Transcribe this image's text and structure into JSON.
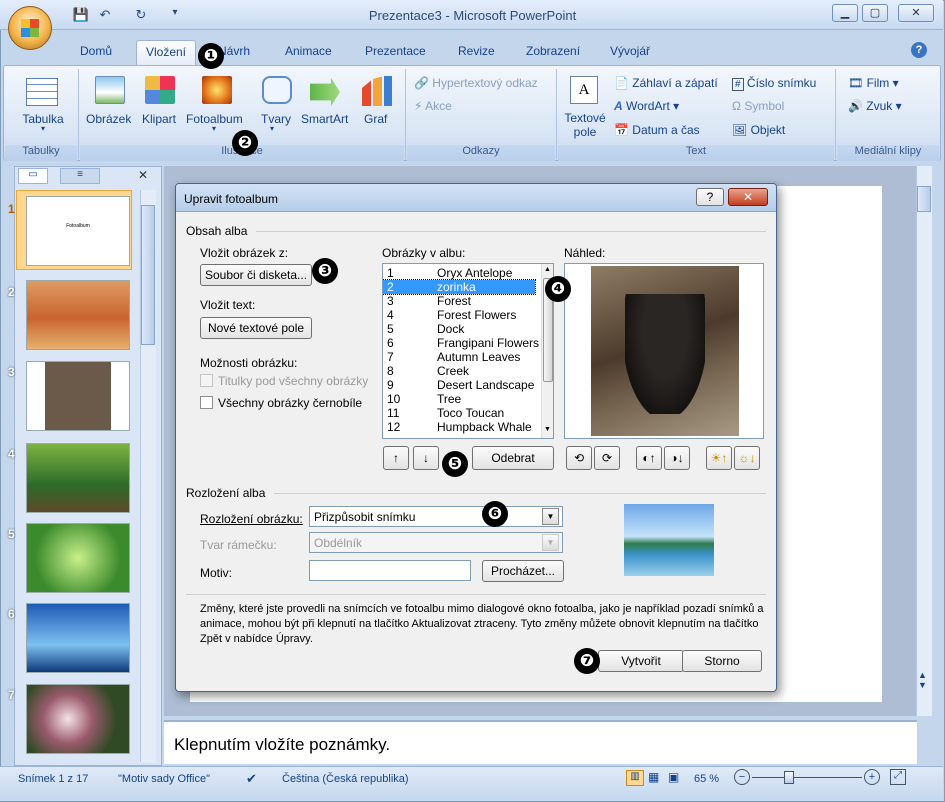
{
  "window": {
    "title": "Prezentace3 - Microsoft PowerPoint"
  },
  "tabs": [
    "Domů",
    "Vložení",
    "Návrh",
    "Animace",
    "Prezentace",
    "Revize",
    "Zobrazení",
    "Vývojář"
  ],
  "ribbon": {
    "tabulka": "Tabulka",
    "obrazek": "Obrázek",
    "klipart": "Klipart",
    "fotoalbum": "Fotoalbum",
    "tvary": "Tvary",
    "smartart": "SmartArt",
    "graf": "Graf",
    "hyper": "Hypertextový odkaz",
    "akce": "Akce",
    "textove_pole": "Textové pole",
    "zahlavi": "Záhlaví a zápatí",
    "wordart": "WordArt",
    "datum": "Datum a čas",
    "cislo": "Číslo snímku",
    "symbol": "Symbol",
    "objekt": "Objekt",
    "film": "Film",
    "zvuk": "Zvuk",
    "groups": {
      "tabulky": "Tabulky",
      "ilustrace": "Ilustrace",
      "odkazy": "Odkazy",
      "text": "Text",
      "media": "Mediální klipy"
    }
  },
  "callouts": [
    "❶",
    "❷",
    "❸",
    "❹",
    "❺",
    "❻",
    "❼"
  ],
  "slides": {
    "numbers": [
      "1",
      "2",
      "3",
      "4",
      "5",
      "6",
      "7"
    ],
    "first_title": "Fotoalbum"
  },
  "dialog": {
    "title": "Upravit fotoalbum",
    "obsah": "Obsah alba",
    "vlozit_obrazek": "Vložit obrázek z:",
    "soubor_btn": "Soubor či disketa...",
    "vlozit_text": "Vložit text:",
    "nove_pole_btn": "Nové textové pole",
    "moznosti": "Možnosti obrázku:",
    "titulky": "Titulky pod všechny obrázky",
    "cernobile": "Všechny obrázky černobíle",
    "obrazky_label": "Obrázky v albu:",
    "nahled": "Náhled:",
    "list": [
      {
        "n": "1",
        "t": "Oryx Antelope"
      },
      {
        "n": "2",
        "t": "zorinka"
      },
      {
        "n": "3",
        "t": "Forest"
      },
      {
        "n": "4",
        "t": "Forest Flowers"
      },
      {
        "n": "5",
        "t": "Dock"
      },
      {
        "n": "6",
        "t": "Frangipani Flowers"
      },
      {
        "n": "7",
        "t": "Autumn Leaves"
      },
      {
        "n": "8",
        "t": "Creek"
      },
      {
        "n": "9",
        "t": "Desert Landscape"
      },
      {
        "n": "10",
        "t": "Tree"
      },
      {
        "n": "11",
        "t": "Toco Toucan"
      },
      {
        "n": "12",
        "t": "Humpback Whale"
      }
    ],
    "odebrat": "Odebrat",
    "rozlozeni_alba": "Rozložení alba",
    "rozlozeni_label": "Rozložení obrázku:",
    "rozlozeni_val": "Přizpůsobit snímku",
    "tvar_label": "Tvar rámečku:",
    "tvar_val": "Obdélník",
    "motiv_label": "Motiv:",
    "prochazet": "Procházet...",
    "note": "Změny, které jste provedli na snímcích ve fotoalbu mimo dialogové okno fotoalba, jako je například pozadí snímků a animace, mohou být při klepnutí na tlačítko Aktualizovat ztraceny. Tyto změny můžete obnovit klepnutím na tlačítko Zpět v nabídce Úpravy.",
    "vytvorit": "Vytvořit",
    "storno": "Storno",
    "help": "?",
    "close": "✕"
  },
  "notes": "Klepnutím vložíte poznámky.",
  "status": {
    "slide": "Snímek 1 z 17",
    "motiv": "\"Motiv sady Office\"",
    "lang": "Čeština (Česká republika)",
    "zoom": "65 %"
  }
}
